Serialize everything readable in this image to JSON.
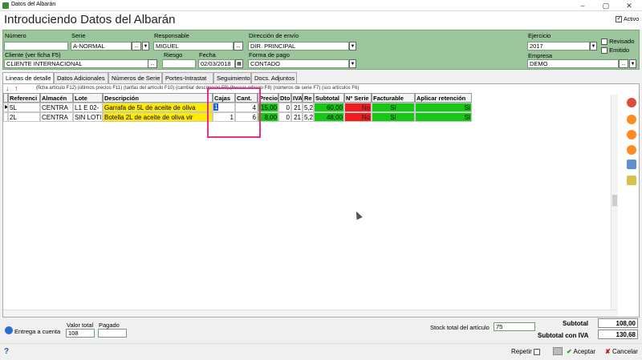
{
  "window": {
    "title": "Datos del Albarán",
    "minimize": "–",
    "maximize": "▢",
    "close": "✕"
  },
  "header": {
    "title": "Introduciendo Datos del Albarán",
    "activo_label": "Activo",
    "activo_checked": "✓"
  },
  "form": {
    "numero_label": "Número",
    "numero_value": "",
    "serie_label": "Serie",
    "serie_value": "A-NORMAL",
    "responsable_label": "Responsable",
    "responsable_value": "MIGUEL",
    "direccion_label": "Dirección de envío",
    "direccion_value": "DIR. PRINCIPAL",
    "ejercicio_label": "Ejercicio",
    "ejercicio_value": "2017",
    "revisado_label": "Revisado",
    "emitido_label": "Emitido",
    "cliente_label": "Cliente  (ver ficha F5)",
    "cliente_value": "CLIENTE INTERNACIONAL",
    "riesgo_label": "Riesgo",
    "riesgo_value": "",
    "fecha_label": "Fecha",
    "fecha_value": "02/03/2018",
    "pago_label": "Forma de pago",
    "pago_value": "CONTADO",
    "empresa_label": "Empresa",
    "empresa_value": "DEMO",
    "ellipsis": "..."
  },
  "tabs": [
    "Lineas de detalle",
    "Datos Adicionales",
    "Números de Serie",
    "Portes-Intrastat",
    "Seguimiento",
    "Docs. Adjuntos"
  ],
  "hints": "(ficha artículo F12) (últimos precios F11) (tarifas del artículo F10) (cambiar descripción F9) (buscar artículo F8) (números de serie F7) (sus artículos F6)",
  "grid": {
    "headers": [
      "Referenci",
      "Almacén",
      "Lote",
      "Descripción",
      "Cajas",
      "Cant.",
      "Precio",
      "Dto",
      "IVA",
      "Re",
      "Subtotal",
      "Nº Serie",
      "Facturable",
      "Aplicar retención"
    ],
    "rows": [
      {
        "marker": "▶",
        "ref": "5L",
        "almacen": "CENTRA",
        "lote": "L1 E 02-",
        "desc": "Garrafa de 5L de aceite de oliva",
        "cajas": "1",
        "cant": "4",
        "precio": "15,00",
        "dto": "0",
        "iva": "21",
        "re": "5,2",
        "subtotal": "60,00",
        "nserie": "No",
        "facturable": "Sí",
        "retencion": "Sí"
      },
      {
        "marker": "",
        "ref": "2L",
        "almacen": "CENTRA",
        "lote": "SIN LOTI",
        "desc": "Botella 2L de aceite de oliva vir",
        "cajas": "1",
        "cant": "6",
        "precio": "8,00",
        "dto": "0",
        "iva": "21",
        "re": "5,2",
        "subtotal": "48,00",
        "nserie": "No",
        "facturable": "Sí",
        "retencion": "Sí"
      }
    ]
  },
  "bottom": {
    "entrega_label": "Entrega a cuenta",
    "valor_total_label": "Valor total",
    "valor_total_value": "108",
    "pagado_label": "Pagado",
    "pagado_value": "",
    "stock_label": "Stock total del artículo",
    "stock_value": "75",
    "subtotal_label": "Subtotal",
    "subtotal_value": "108,00",
    "subtotal_iva_label": "Subtotal con IVA",
    "subtotal_iva_value": "130,68",
    "help": "?",
    "repetir_label": "Repetir",
    "aceptar_label": "Aceptar",
    "cancelar_label": "Cancelar"
  },
  "colors": {
    "form_bg": "#9bc59b",
    "yellow": "#ffeb00",
    "green": "#14c814",
    "red": "#ee1c1c",
    "highlight": "#e62e8a"
  }
}
